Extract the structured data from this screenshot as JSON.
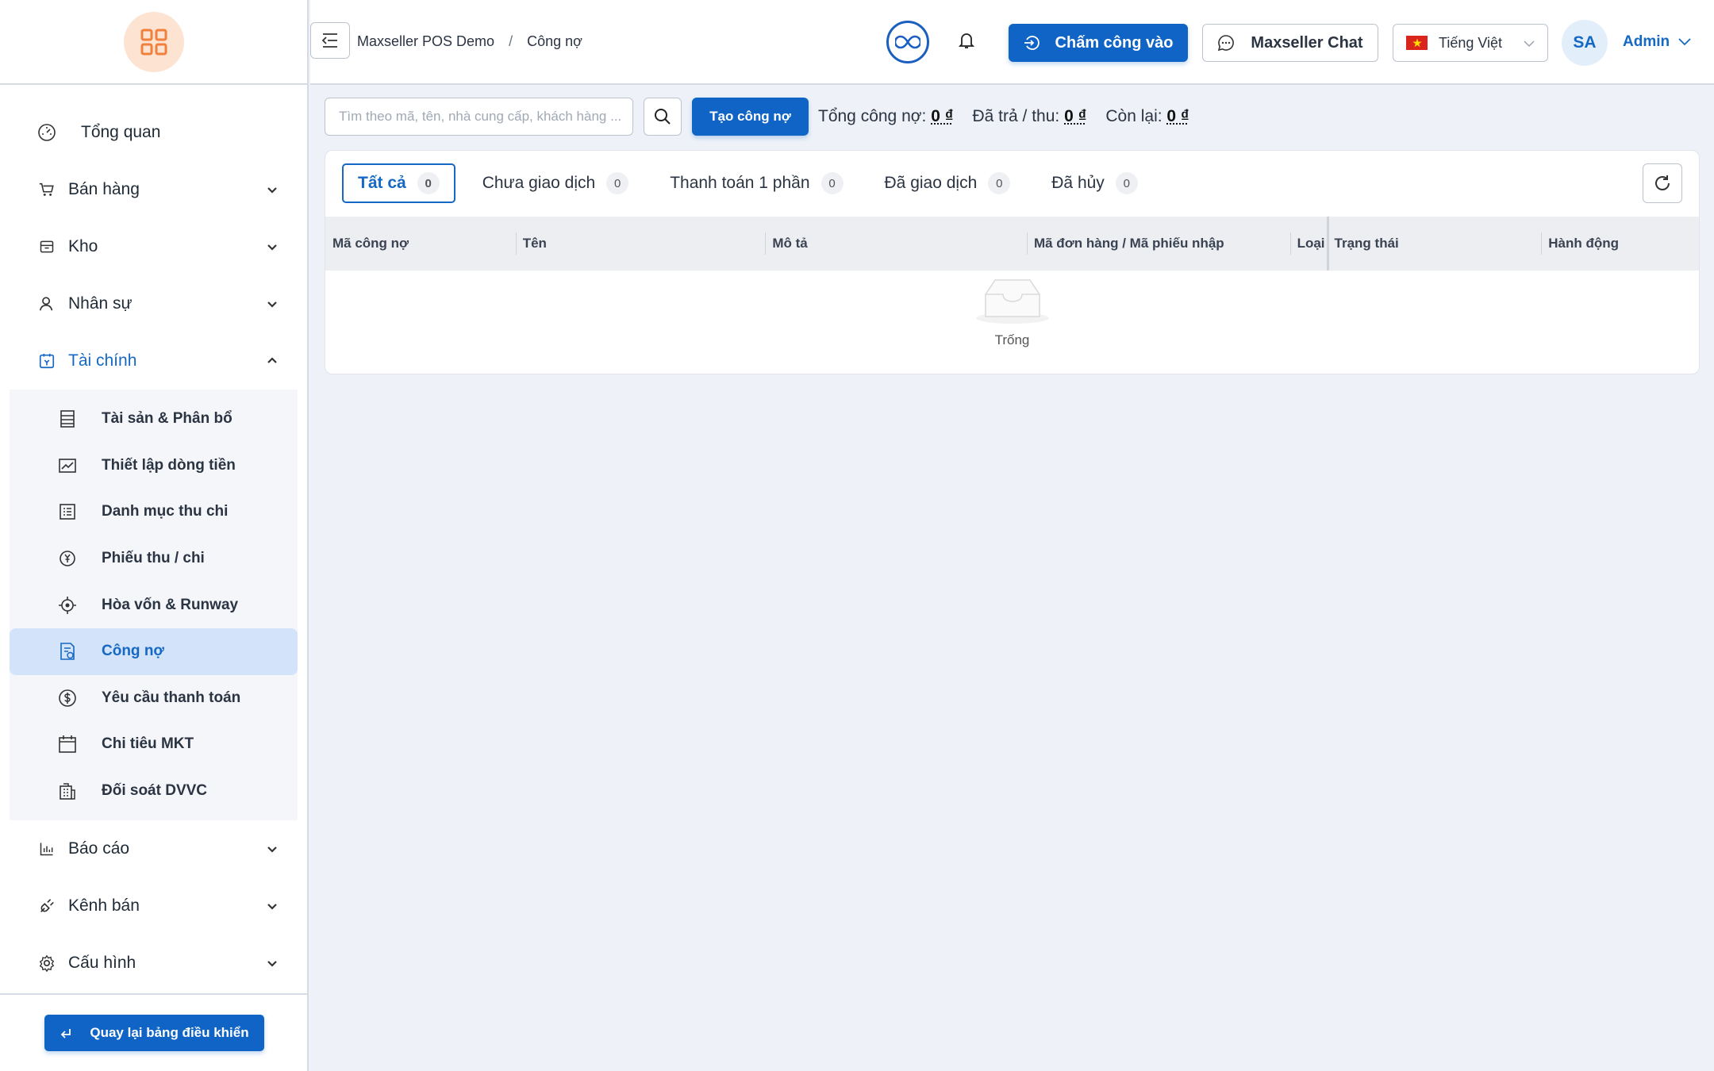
{
  "sidebar": {
    "items": [
      {
        "label": "Tổng quan"
      },
      {
        "label": "Bán hàng"
      },
      {
        "label": "Kho"
      },
      {
        "label": "Nhân sự"
      },
      {
        "label": "Tài chính"
      },
      {
        "label": "Báo cáo"
      },
      {
        "label": "Kênh bán"
      },
      {
        "label": "Cấu hình"
      }
    ],
    "finance_sub": [
      {
        "label": "Tài sản & Phân bổ"
      },
      {
        "label": "Thiết lập dòng tiền"
      },
      {
        "label": "Danh mục thu chi"
      },
      {
        "label": "Phiếu thu / chi"
      },
      {
        "label": "Hòa vốn & Runway"
      },
      {
        "label": "Công nợ"
      },
      {
        "label": "Yêu cầu thanh toán"
      },
      {
        "label": "Chi tiêu MKT"
      },
      {
        "label": "Đối soát DVVC"
      }
    ],
    "back_label": "Quay lại bảng điều khiển"
  },
  "header": {
    "breadcrumb": [
      "Maxseller POS Demo",
      "/",
      "Công nợ"
    ],
    "clock_in_label": "Chấm công vào",
    "chat_label": "Maxseller Chat",
    "language": "Tiếng Việt",
    "avatar_initials": "SA",
    "user_label": "Admin"
  },
  "toolbar": {
    "search_placeholder": "Tìm theo mã, tên, nhà cung cấp, khách hàng ...",
    "create_label": "Tạo công nợ",
    "total_label": "Tổng công nợ:",
    "total_value": "0 ₫",
    "paid_label": "Đã trả / thu:",
    "paid_value": "0 ₫",
    "remaining_label": "Còn lại:",
    "remaining_value": "0 ₫"
  },
  "tabs": [
    {
      "label": "Tất cả",
      "count": "0"
    },
    {
      "label": "Chưa giao dịch",
      "count": "0"
    },
    {
      "label": "Thanh toán 1 phần",
      "count": "0"
    },
    {
      "label": "Đã giao dịch",
      "count": "0"
    },
    {
      "label": "Đã hủy",
      "count": "0"
    }
  ],
  "table": {
    "columns": [
      "Mã công nợ",
      "Tên",
      "Mô tả",
      "Mã đơn hàng / Mã phiếu nhập",
      "Loại",
      "Trạng thái",
      "Hành động"
    ],
    "empty_text": "Trống"
  },
  "colors": {
    "accent": "#1568c4",
    "primary_button": "#0f64c6",
    "logo_bg": "#fde3d2",
    "logo_fg": "#f0803c"
  }
}
